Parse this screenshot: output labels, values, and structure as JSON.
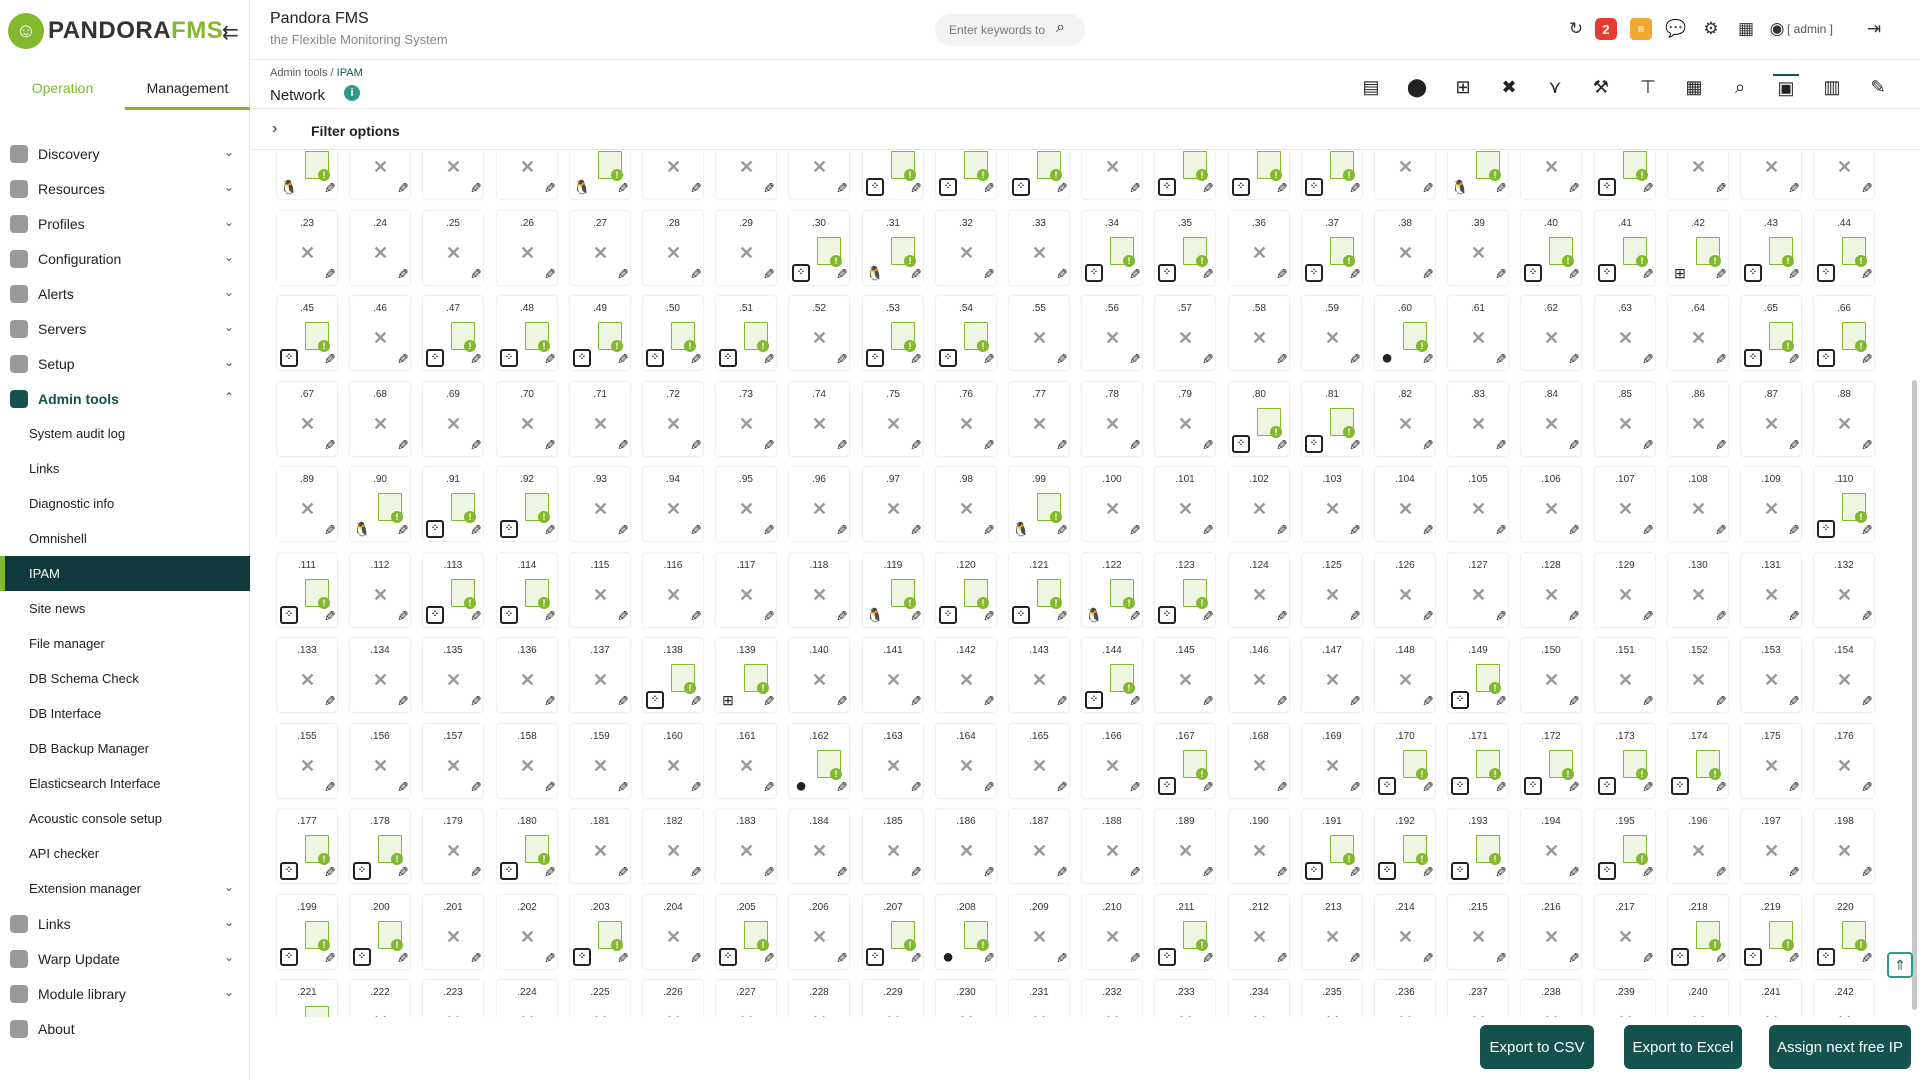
{
  "app": {
    "name": "Pandora FMS",
    "tagline": "the Flexible Monitoring System",
    "logo_text_a": "PANDORA",
    "logo_text_b": "FMS"
  },
  "modes": {
    "operation": "Operation",
    "management": "Management"
  },
  "menu": [
    {
      "label": "Discovery",
      "icon": "discovery-icon"
    },
    {
      "label": "Resources",
      "icon": "resources-icon"
    },
    {
      "label": "Profiles",
      "icon": "profiles-icon"
    },
    {
      "label": "Configuration",
      "icon": "configuration-icon"
    },
    {
      "label": "Alerts",
      "icon": "alerts-icon"
    },
    {
      "label": "Servers",
      "icon": "servers-icon"
    },
    {
      "label": "Setup",
      "icon": "setup-icon"
    },
    {
      "label": "Admin tools",
      "icon": "admin-tools-icon"
    }
  ],
  "submenu": [
    "System audit log",
    "Links",
    "Diagnostic info",
    "Omnishell",
    "IPAM",
    "Site news",
    "File manager",
    "DB Schema Check",
    "DB Interface",
    "DB Backup Manager",
    "Elasticsearch Interface",
    "Acoustic console setup",
    "API checker",
    "Extension manager"
  ],
  "menu_bottom": [
    {
      "label": "Links",
      "icon": "links-icon"
    },
    {
      "label": "Warp Update",
      "icon": "warp-update-icon"
    },
    {
      "label": "Module library",
      "icon": "module-library-icon"
    },
    {
      "label": "About",
      "icon": "about-icon"
    }
  ],
  "header": {
    "search_placeholder": "Enter keywords to",
    "notification_count": "2",
    "user_label": "[ admin ]"
  },
  "page": {
    "breadcrumb_root": "Admin tools",
    "breadcrumb_leaf": "IPAM",
    "title": "Network"
  },
  "filter": {
    "label": "Filter options"
  },
  "buttons": {
    "export_csv": "Export to CSV",
    "export_excel": "Export to Excel",
    "assign_next": "Assign next free IP"
  },
  "colors": {
    "accent": "#82b92e",
    "dark": "#14524f"
  },
  "ipam": {
    "first": 1,
    "last": 242,
    "per_row": 22,
    "hosts": {
      "1": "linux",
      "5": "linux",
      "9": "grid",
      "10": "grid",
      "11": "grid",
      "13": "grid",
      "14": "grid",
      "15": "grid",
      "17": "linux",
      "19": "grid",
      "30": "grid",
      "31": "linux",
      "34": "grid",
      "35": "grid",
      "37": "grid",
      "40": "grid",
      "41": "grid",
      "42": "windows",
      "43": "grid",
      "44": "grid",
      "45": "grid",
      "47": "grid",
      "48": "grid",
      "49": "grid",
      "50": "grid",
      "51": "grid",
      "53": "grid",
      "54": "grid",
      "60": "black",
      "65": "grid",
      "66": "grid",
      "80": "grid",
      "81": "grid",
      "90": "linux",
      "91": "grid",
      "92": "grid",
      "99": "linux",
      "110": "grid",
      "111": "grid",
      "113": "grid",
      "114": "grid",
      "119": "linux",
      "120": "grid",
      "121": "grid",
      "122": "linux",
      "123": "grid",
      "138": "grid",
      "139": "windows",
      "144": "grid",
      "149": "grid",
      "162": "black",
      "167": "grid",
      "170": "grid",
      "171": "grid",
      "172": "grid",
      "173": "grid",
      "174": "grid",
      "177": "grid",
      "178": "grid",
      "180": "grid",
      "191": "grid",
      "192": "grid",
      "193": "grid",
      "195": "grid",
      "199": "grid",
      "200": "grid",
      "203": "grid",
      "205": "grid",
      "207": "grid",
      "208": "black",
      "211": "grid",
      "218": "grid",
      "219": "grid",
      "220": "grid",
      "221": "grid"
    }
  }
}
